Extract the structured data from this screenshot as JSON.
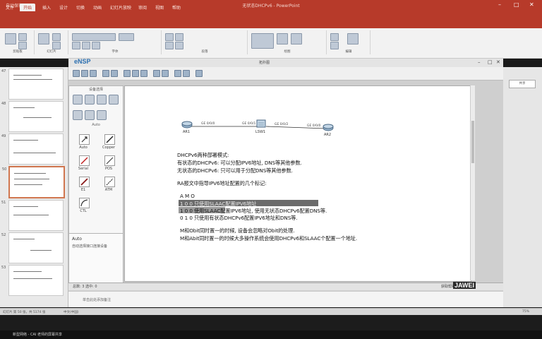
{
  "ppt": {
    "window_title": "无状态DHCPv6 - PowerPoint",
    "qat": "自动保存",
    "tabs": [
      "文件",
      "开始",
      "插入",
      "设计",
      "切换",
      "动画",
      "幻灯片放映",
      "审阅",
      "视图",
      "帮助"
    ],
    "active_tab": "开始",
    "ribbon_groups": [
      "剪贴板",
      "幻灯片",
      "字体",
      "段落",
      "绘图",
      "编辑"
    ],
    "status_left": "幻灯片 第 50 张，共 5174 张",
    "status_lang": "中文(中国)",
    "notes_placeholder": "单击此处添加备注",
    "share_btn": "共享",
    "zoom": "75%"
  },
  "thumbnails": [
    {
      "num": "47"
    },
    {
      "num": "48"
    },
    {
      "num": "49"
    },
    {
      "num": "50"
    },
    {
      "num": "51"
    },
    {
      "num": "52"
    },
    {
      "num": "53"
    }
  ],
  "ensp": {
    "brand": "eNSP",
    "window_title": "拓扑图",
    "device_panel_title": "设备选择",
    "sub_title": "Auto",
    "devices": [
      {
        "name": "Auto"
      },
      {
        "name": "Copper"
      },
      {
        "name": "Serial"
      },
      {
        "name": "POS"
      },
      {
        "name": "E1"
      },
      {
        "name": "ATM"
      },
      {
        "name": "CTL"
      }
    ],
    "info_title": "Auto",
    "info_desc": "自动选择接口连接设备",
    "status": "总数: 3  选中: 0",
    "status_right": "获取帮助与反馈"
  },
  "topology": {
    "nodes": [
      {
        "name": "AR1"
      },
      {
        "name": "LSW1"
      },
      {
        "name": "AR2"
      }
    ],
    "ports": [
      "GE 0/0/0",
      "GE 0/0/1",
      "GE 0/0/2",
      "GE 0/0/0"
    ]
  },
  "slide": {
    "lines": [
      "DHCPv6两种部署模式:",
      "  有状态的DHCPv6: 可以分配IPV6地址, DNS等其他参数.",
      "  无状态的DHCPv6: 只可以用于分配DNS等其他参数.",
      "RA报文中指导IPV6地址配置的几个标记:",
      "A   M   O",
      "1   0   0    只使用SLAAC配置IPV6地址",
      "1   0   0    使用SLAAC配置IPV6地址, 使用无状态DHCPv6配置DNS等.",
      "0   1   0    只使用有状态DHCPv6配置IPV6地址和DNS等.",
      "M和Obit同时置一的时候, 设备会忽略对Obit的处理.",
      "M和Abit同时置一的时候大多操作系统会使用DHCPv6和SLAAC个配置一个地址."
    ]
  },
  "watermark": "JAWEI",
  "taskbar": {
    "item1": "新型网络 - CAI 老师的屏幕共享"
  }
}
